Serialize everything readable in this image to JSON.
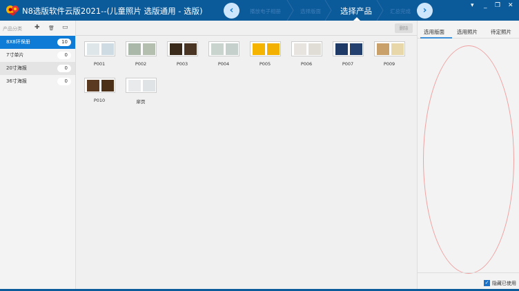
{
  "window": {
    "title": "N8选版软件云版2021--(儿童照片 选版通用 - 选版)"
  },
  "steps": [
    {
      "label": "播放电子相册"
    },
    {
      "label": "选择版面"
    },
    {
      "label": "选择产品"
    },
    {
      "label": "汇总完成"
    }
  ],
  "nav": {
    "prev": "‹",
    "next": "›"
  },
  "window_controls": {
    "menu": "▾",
    "minimize": "_",
    "restore": "❐",
    "close": "✕"
  },
  "sidebar": {
    "header": "产品分类",
    "add": "✚",
    "delete": "🗑",
    "view": "▭",
    "categories": [
      {
        "label": "8X8环保册",
        "count": "10"
      },
      {
        "label": "7寸单片",
        "count": "0"
      },
      {
        "label": "20寸海报",
        "count": "0"
      },
      {
        "label": "36寸海报",
        "count": "0"
      }
    ]
  },
  "main": {
    "delete_button": "删除",
    "items": [
      {
        "label": "P001",
        "c1": "#dfe6ea",
        "c2": "#cfdbe3"
      },
      {
        "label": "P002",
        "c1": "#a9b8a8",
        "c2": "#b4bfb0"
      },
      {
        "label": "P003",
        "c1": "#3a2a1c",
        "c2": "#4a3424"
      },
      {
        "label": "P004",
        "c1": "#c9d4cf",
        "c2": "#c5d0cc"
      },
      {
        "label": "P005",
        "c1": "#f5b400",
        "c2": "#f3b000"
      },
      {
        "label": "P006",
        "c1": "#e7e3de",
        "c2": "#e0dcd6"
      },
      {
        "label": "P007",
        "c1": "#1f3a66",
        "c2": "#24406e"
      },
      {
        "label": "P009",
        "c1": "#c9a06a",
        "c2": "#e8d7a8"
      },
      {
        "label": "P010",
        "c1": "#5a3a20",
        "c2": "#4d3018"
      },
      {
        "label": "扉页",
        "c1": "#e8eaec",
        "c2": "#dfe3e6"
      }
    ]
  },
  "right_panel": {
    "tabs": [
      {
        "label": "选用版面"
      },
      {
        "label": "选用照片"
      },
      {
        "label": "待定照片"
      }
    ],
    "hide_used": {
      "label": "隐藏已使用",
      "checked": true
    }
  }
}
